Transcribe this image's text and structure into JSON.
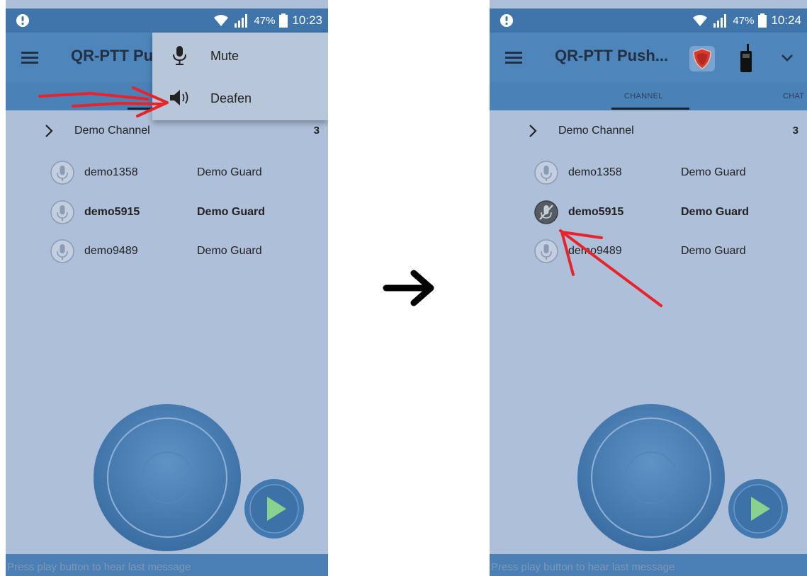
{
  "colors": {
    "screen_bg": "#adbfd9",
    "statusbar": "#3f75aa",
    "appbar": "#4e86bb",
    "tabbar": "#4a82b8",
    "annotation_red": "#e8232a"
  },
  "left_screen": {
    "status": {
      "battery": "47%",
      "time": "10:23"
    },
    "app_title": "QR-PTT Pu",
    "menu": {
      "items": [
        {
          "label": "Mute",
          "icon": "microphone-icon"
        },
        {
          "label": "Deafen",
          "icon": "speaker-icon"
        }
      ]
    },
    "channel": {
      "name": "Demo Channel",
      "count": "3"
    },
    "users": [
      {
        "name": "demo1358",
        "role": "Demo Guard"
      },
      {
        "name": "demo5915",
        "role": "Demo Guard"
      },
      {
        "name": "demo9489",
        "role": "Demo Guard"
      }
    ],
    "bottom_text": "Press play button to hear last message"
  },
  "right_screen": {
    "status": {
      "battery": "47%",
      "time": "10:24"
    },
    "app_title": "QR-PTT Push...",
    "tabs": [
      {
        "label": "CHANNEL"
      },
      {
        "label": "CHAT"
      }
    ],
    "channel": {
      "name": "Demo Channel",
      "count": "3"
    },
    "users": [
      {
        "name": "demo1358",
        "role": "Demo Guard"
      },
      {
        "name": "demo5915",
        "role": "Demo Guard",
        "state": "deafened"
      },
      {
        "name": "demo9489",
        "role": "Demo Guard"
      }
    ],
    "bottom_text": "Press play button to hear last message"
  }
}
